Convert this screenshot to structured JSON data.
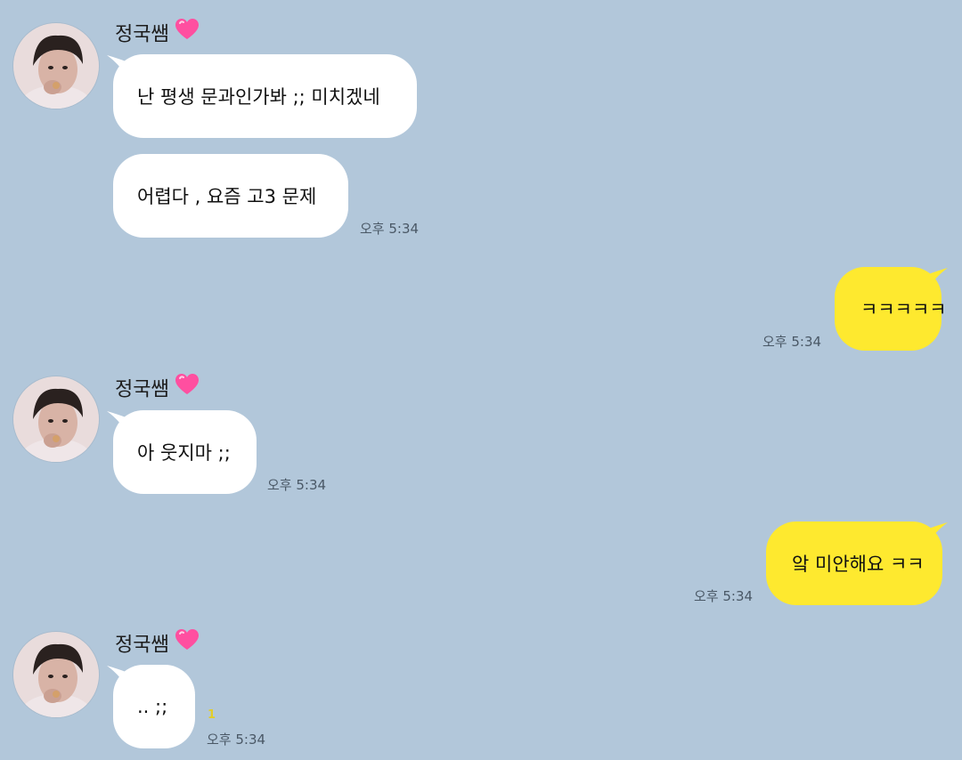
{
  "chat": {
    "sender_name": "정국쌤",
    "messages": [
      {
        "from": "them",
        "text": "난 평생 문과인가봐 ;; 미치겠네"
      },
      {
        "from": "them",
        "text": "어렵다 , 요즘 고3 문제",
        "time": "오후 5:34"
      },
      {
        "from": "me",
        "text": "ㅋㅋㅋㅋㅋ",
        "time": "오후 5:34"
      },
      {
        "from": "them",
        "text": "아 웃지마 ;;",
        "time": "오후 5:34"
      },
      {
        "from": "me",
        "text": "앜 미안해요 ㅋㅋ",
        "time": "오후 5:34"
      },
      {
        "from": "them",
        "text": ".. ;;",
        "time": "오후 5:34",
        "unread": "1"
      }
    ]
  },
  "colors": {
    "background": "#b2c7da",
    "incoming_bubble": "#ffffff",
    "outgoing_bubble": "#fee92f",
    "heart": "#ff4fa0"
  },
  "icons": {
    "sender_emoji": "pink-heart-icon",
    "avatar": "profile-photo"
  }
}
